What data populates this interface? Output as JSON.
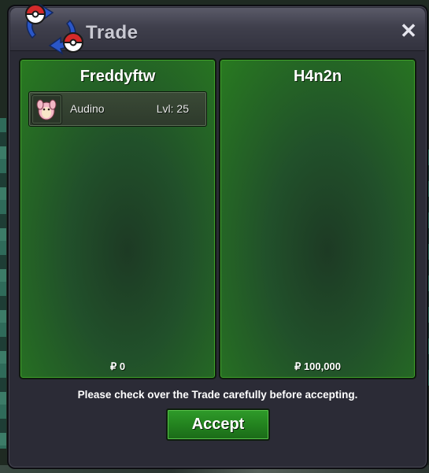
{
  "window": {
    "title": "Trade",
    "close_label": "✕"
  },
  "offers": [
    {
      "player": "Freddyftw",
      "pokemon": [
        {
          "name": "Audino",
          "level": "Lvl: 25",
          "icon": "audino-sprite-icon"
        }
      ],
      "money": "₽ 0"
    },
    {
      "player": "H4n2n",
      "pokemon": [],
      "money": "₽ 100,000"
    }
  ],
  "notice": "Please check over the Trade carefully before accepting.",
  "accept_label": "Accept",
  "colors": {
    "panel_green": "#287a20",
    "window_bg": "#2b2b36",
    "accept_green": "#2f9b2a"
  }
}
